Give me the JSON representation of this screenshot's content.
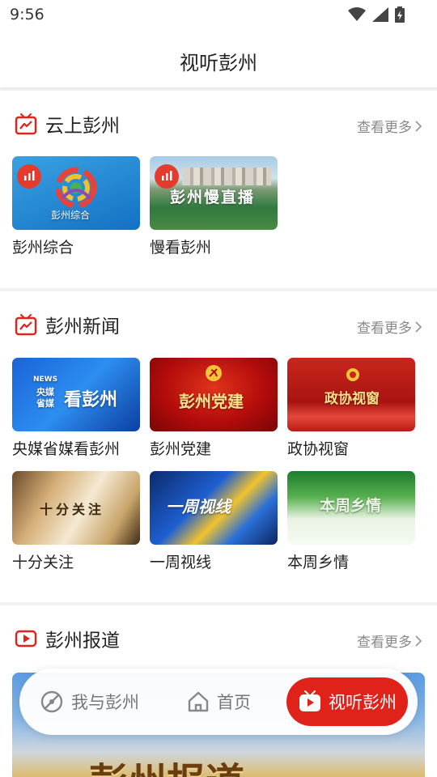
{
  "status": {
    "time": "9:56"
  },
  "header": {
    "title": "视听彭州"
  },
  "sections": [
    {
      "title": "云上彭州",
      "more": "查看更多",
      "items": [
        {
          "label": "彭州综合",
          "thumb_text": "彭州综合"
        },
        {
          "label": "慢看彭州",
          "thumb_text": "彭州慢直播"
        }
      ]
    },
    {
      "title": "彭州新闻",
      "more": "查看更多",
      "items": [
        {
          "label": "央媒省媒看彭州",
          "thumb_text": "看彭州",
          "thumb_sub1": "央媒",
          "thumb_sub2": "省媒",
          "thumb_news": "NEWS"
        },
        {
          "label": "彭州党建",
          "thumb_text": "彭州党建"
        },
        {
          "label": "政协视窗",
          "thumb_text": "政协视窗"
        },
        {
          "label": "十分关注",
          "thumb_text": "十分关注"
        },
        {
          "label": "一周视线",
          "thumb_text": "一周视线"
        },
        {
          "label": "本周乡情",
          "thumb_text": "本周乡情"
        }
      ]
    },
    {
      "title": "彭州报道",
      "more": "查看更多",
      "banner_text": "彭州报道"
    }
  ],
  "nav": {
    "items": [
      {
        "label": "我与彭州",
        "icon": "compass-icon"
      },
      {
        "label": "首页",
        "icon": "home-icon"
      },
      {
        "label": "视听彭州",
        "icon": "tv-play-icon"
      }
    ]
  },
  "colors": {
    "accent": "#e0231a",
    "badge": "#e53b2d"
  }
}
